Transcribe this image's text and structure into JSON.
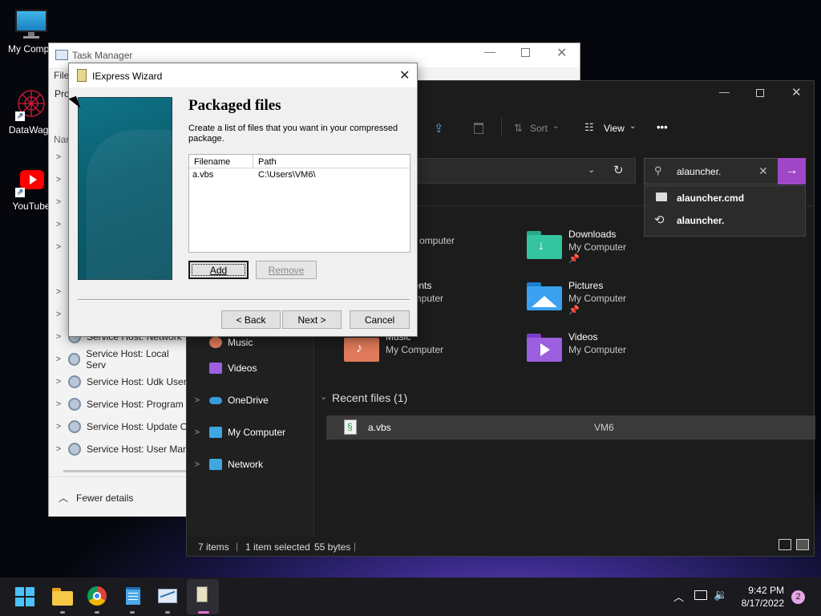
{
  "desktop": {
    "icons": [
      {
        "label": "My Compu",
        "icon": "monitor-icon"
      },
      {
        "label": "DataWago",
        "icon": "datawagon-icon"
      },
      {
        "label": "YouTube",
        "icon": "youtube-icon"
      }
    ]
  },
  "task_manager": {
    "title": "Task Manager",
    "menu_file": "File",
    "tab_processes": "Pro",
    "col_name": "Nam",
    "rows": [
      "Service Host: Network",
      "Service Host: Local Serv",
      "Service Host: Udk User",
      "Service Host: Program",
      "Service Host: Update O",
      "Service Host: User Man"
    ],
    "fewer_details": "Fewer details"
  },
  "explorer": {
    "toolbar": {
      "sort": "Sort",
      "view": "View",
      "more": "•••"
    },
    "search": {
      "value": "alauncher.",
      "suggestions": [
        "alauncher.cmd",
        "alauncher."
      ]
    },
    "quick_access": [
      {
        "name": "",
        "sub": "omputer"
      },
      {
        "name": "Downloads",
        "sub": "My Computer",
        "pinned": true
      },
      {
        "name": "nents",
        "sub": "omputer"
      },
      {
        "name": "Pictures",
        "sub": "My Computer",
        "pinned": true
      },
      {
        "name": "Music",
        "sub": "My Computer"
      },
      {
        "name": "Videos",
        "sub": "My Computer"
      }
    ],
    "nav": [
      {
        "label": "Music",
        "icon": "music-icon"
      },
      {
        "label": "Videos",
        "icon": "videos-icon"
      },
      {
        "label": "OneDrive",
        "icon": "onedrive-icon"
      },
      {
        "label": "My Computer",
        "icon": "computer-icon"
      },
      {
        "label": "Network",
        "icon": "network-icon"
      }
    ],
    "recent": {
      "header": "Recent files (1)",
      "files": [
        {
          "name": "a.vbs",
          "location": "VM6"
        }
      ]
    },
    "status": {
      "items": "7 items",
      "selected": "1 item selected",
      "size": "55 bytes"
    }
  },
  "iexpress": {
    "title": "IExpress Wizard",
    "heading": "Packaged files",
    "description": "Create a list of files that you want in your compressed package.",
    "columns": [
      "Filename",
      "Path"
    ],
    "files": [
      {
        "filename": "a.vbs",
        "path": "C:\\Users\\VM6\\"
      }
    ],
    "buttons": {
      "add": "Add",
      "remove": "Remove",
      "back": "< Back",
      "next": "Next >",
      "cancel": "Cancel"
    }
  },
  "taskbar": {
    "time": "9:42 PM",
    "date": "8/17/2022",
    "notifications": "2"
  },
  "colors": {
    "accent": "#a047c8",
    "teal": "#0b5e70",
    "dark": "#1c1c1c"
  }
}
